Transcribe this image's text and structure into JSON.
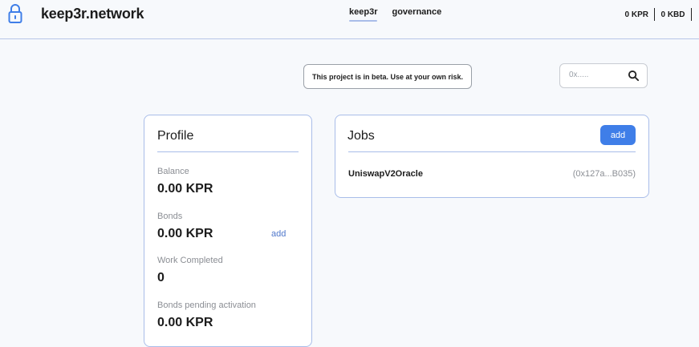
{
  "app": {
    "brand": "keep3r.network"
  },
  "nav": {
    "items": [
      {
        "label": "keep3r",
        "active": true
      },
      {
        "label": "governance",
        "active": false
      }
    ]
  },
  "wallet": {
    "kpr_balance": "0 KPR",
    "kbd_balance": "0 KBD"
  },
  "notice": {
    "beta": "This project is in beta. Use at your own risk."
  },
  "search": {
    "placeholder": "0x....."
  },
  "profile": {
    "title": "Profile",
    "stats": [
      {
        "label": "Balance",
        "value": "0.00 KPR"
      },
      {
        "label": "Bonds",
        "value": "0.00 KPR"
      },
      {
        "label": "Work Completed",
        "value": "0"
      },
      {
        "label": "Bonds pending activation",
        "value": "0.00 KPR"
      }
    ],
    "bonds_add_label": "add"
  },
  "jobs": {
    "title": "Jobs",
    "add_label": "add",
    "items": [
      {
        "name": "UniswapV2Oracle",
        "address": "(0x127a...B035)"
      }
    ]
  },
  "colors": {
    "accent": "#3f7ee8",
    "border": "#a9bde9",
    "muted_text": "#8b8e94"
  },
  "icons": {
    "logo": "padlock-icon",
    "search": "search-icon"
  }
}
